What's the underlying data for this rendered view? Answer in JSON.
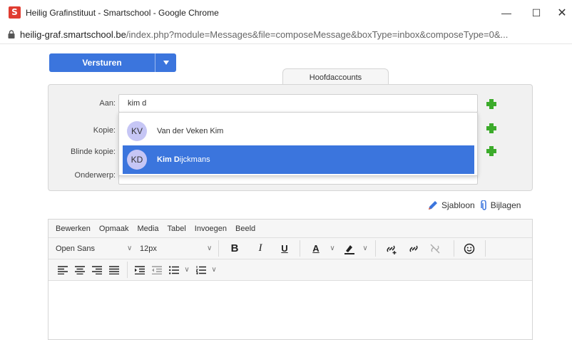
{
  "window": {
    "title": "Heilig Grafinstituut - Smartschool - Google Chrome",
    "app_letter": "S",
    "minimize": "—",
    "maximize": "☐",
    "close": "✕"
  },
  "address": {
    "host": "heilig-graf.smartschool.be",
    "path": "/index.php?module=Messages&file=composeMessage&boxType=inbox&composeType=0&..."
  },
  "compose": {
    "send_label": "Versturen",
    "tab_label": "Hoofdaccounts",
    "fields": {
      "to_label": "Aan:",
      "to_value": "kim d",
      "cc_label": "Kopie:",
      "bcc_label": "Blinde kopie:",
      "subject_label": "Onderwerp:"
    },
    "suggestions": [
      {
        "initials": "KV",
        "name": "Van der Veken Kim",
        "selected": false
      },
      {
        "initials": "KD",
        "name_bold_1": "Kim D",
        "name_rest": "ijckmans",
        "selected": true
      }
    ],
    "template_label": "Sjabloon",
    "attachments_label": "Bijlagen"
  },
  "editor": {
    "menu": [
      "Bewerken",
      "Opmaak",
      "Media",
      "Tabel",
      "Invoegen",
      "Beeld"
    ],
    "font_family": "Open Sans",
    "font_size": "12px",
    "bold_label": "B",
    "italic_label": "I",
    "underline_label": "U",
    "text_color_label": "A"
  },
  "colors": {
    "accent": "#3b75dd",
    "plus": "#3cab2b",
    "avatar": "#c6c6f5"
  }
}
